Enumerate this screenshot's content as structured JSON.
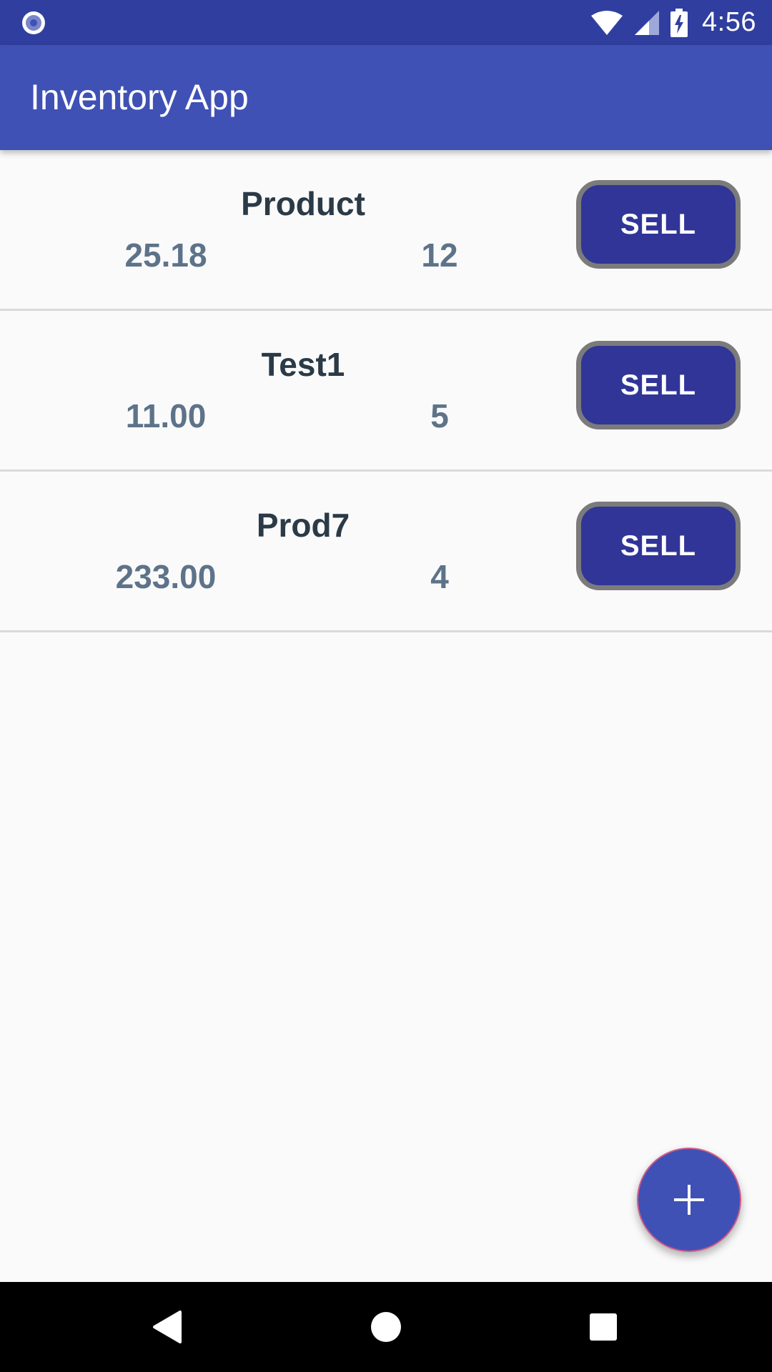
{
  "status_bar": {
    "time": "4:56",
    "icons": [
      "notification-dot-icon",
      "wifi-icon",
      "signal-icon",
      "battery-charging-icon"
    ]
  },
  "app_bar": {
    "title": "Inventory App"
  },
  "products": [
    {
      "name": "Product",
      "price": "25.18",
      "quantity": "12",
      "sell_label": "SELL"
    },
    {
      "name": "Test1",
      "price": "11.00",
      "quantity": "5",
      "sell_label": "SELL"
    },
    {
      "name": "Prod7",
      "price": "233.00",
      "quantity": "4",
      "sell_label": "SELL"
    }
  ],
  "fab": {
    "icon": "plus-icon"
  },
  "nav_bar": {
    "icons": [
      "back-icon",
      "home-icon",
      "recents-icon"
    ]
  },
  "colors": {
    "status_bar": "#303f9f",
    "app_bar": "#3f51b5",
    "sell_button": "#303597",
    "background": "#fafafa"
  }
}
